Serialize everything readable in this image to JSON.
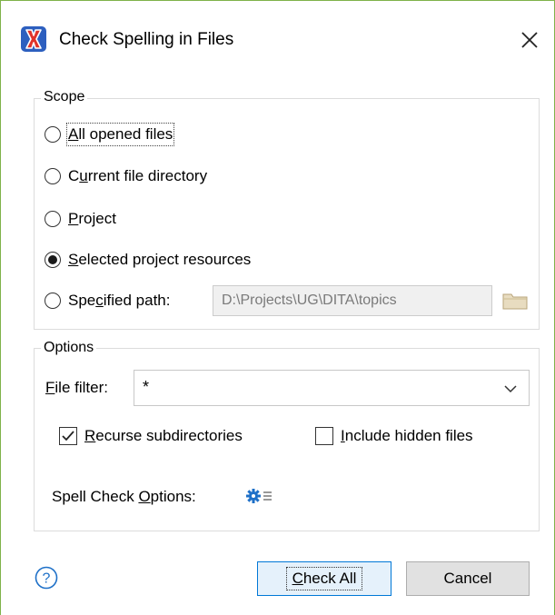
{
  "window": {
    "title": "Check Spelling in Files",
    "icon": "oxygen-app-icon",
    "close_icon": "close-icon"
  },
  "scope": {
    "legend": "Scope",
    "options": [
      {
        "label": "All opened files",
        "mnemonic": "A",
        "selected": false
      },
      {
        "label": "Current file directory",
        "mnemonic": "u",
        "selected": false
      },
      {
        "label": "Project",
        "mnemonic": "P",
        "selected": false
      },
      {
        "label": "Selected project resources",
        "mnemonic": "S",
        "selected": true
      },
      {
        "label": "Specified path:",
        "mnemonic": "c",
        "selected": false
      }
    ],
    "path_value": "D:\\Projects\\UG\\DITA\\topics",
    "browse_icon": "folder-icon"
  },
  "options": {
    "legend": "Options",
    "file_filter_label": "File filter:",
    "file_filter_value": "*",
    "recurse_label": "Recurse subdirectories",
    "recurse_checked": true,
    "hidden_label": "Include hidden files",
    "hidden_checked": false,
    "spell_check_options_label": "Spell Check Options:",
    "spell_check_options_icon": "settings-gear-icon"
  },
  "footer": {
    "help_icon": "help-icon",
    "check_all_label": "Check All",
    "cancel_label": "Cancel"
  },
  "colors": {
    "accent_border": "#0078d7",
    "window_border": "#7fb24a",
    "icon_blue": "#1e70c8",
    "app_icon_blue": "#2d5fbf",
    "app_icon_red": "#e0322a"
  }
}
